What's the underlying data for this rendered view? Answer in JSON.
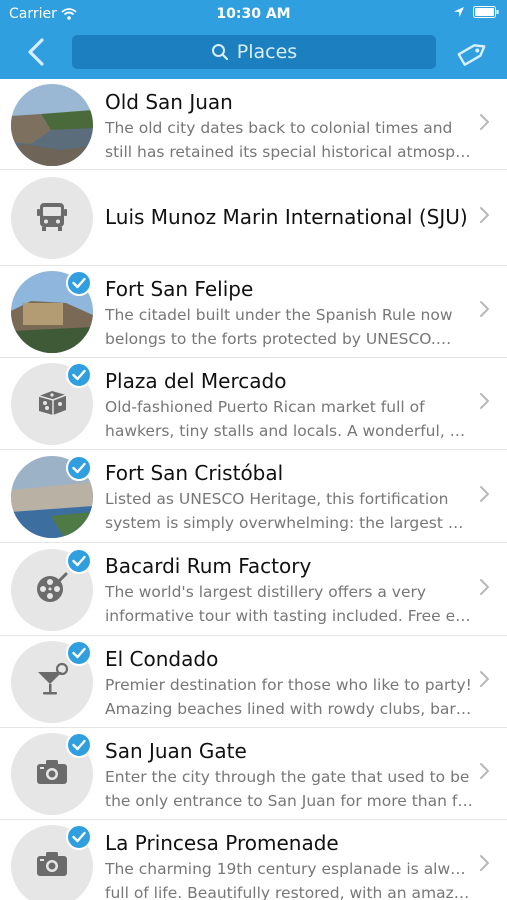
{
  "status_bar": {
    "carrier": "Carrier",
    "time": "10:30 AM"
  },
  "nav": {
    "search_placeholder": "Places",
    "back_icon": "chevron-left-icon",
    "tag_icon": "tag-icon"
  },
  "colors": {
    "accent": "#2f9fe0",
    "search_bg": "#1b7fc0",
    "thumb_bg": "#e6e6e6",
    "icon_gray": "#6b6b6b"
  },
  "places": [
    {
      "title": "Old San Juan",
      "desc_line1": "The old city dates back to colonial times and",
      "desc_line2": "still has retained its special historical atmosp…",
      "thumb": "photo",
      "checked": false
    },
    {
      "title": "Luis Munoz Marin International (SJU)",
      "thumb": "bus-icon",
      "checked": false
    },
    {
      "title": "Fort San Felipe",
      "desc_line1": "The citadel built under the Spanish Rule now",
      "desc_line2": "belongs to the forts protected by UNESCO.…",
      "thumb": "photo",
      "checked": true
    },
    {
      "title": "Plaza del Mercado",
      "desc_line1": "Old-fashioned Puerto Rican market full of",
      "desc_line2": "hawkers, tiny stalls and locals. A wonderful, g…",
      "thumb": "dice-icon",
      "checked": true
    },
    {
      "title": "Fort San Cristóbal",
      "desc_line1": "Listed as UNESCO Heritage, this fortification",
      "desc_line2": "system is simply overwhelming: the largest S…",
      "thumb": "photo",
      "checked": true
    },
    {
      "title": "Bacardi Rum Factory",
      "desc_line1": "The world's largest distillery offers a very",
      "desc_line2": "informative tour with tasting included. Free e…",
      "thumb": "film-reel-icon",
      "checked": true
    },
    {
      "title": "El Condado",
      "desc_line1": "Premier destination for those who like to party!",
      "desc_line2": "Amazing beaches lined with rowdy clubs, bar…",
      "thumb": "cocktail-icon",
      "checked": true
    },
    {
      "title": "San Juan Gate",
      "desc_line1": "Enter the city through the gate that used to be",
      "desc_line2": "the only entrance to San Juan for more than f…",
      "thumb": "camera-icon",
      "checked": true
    },
    {
      "title": "La Princesa Promenade",
      "desc_line1": "The charming 19th century esplanade is always",
      "desc_line2": "full of life. Beautifully restored, with an amazi…",
      "thumb": "camera-icon",
      "checked": true
    }
  ]
}
